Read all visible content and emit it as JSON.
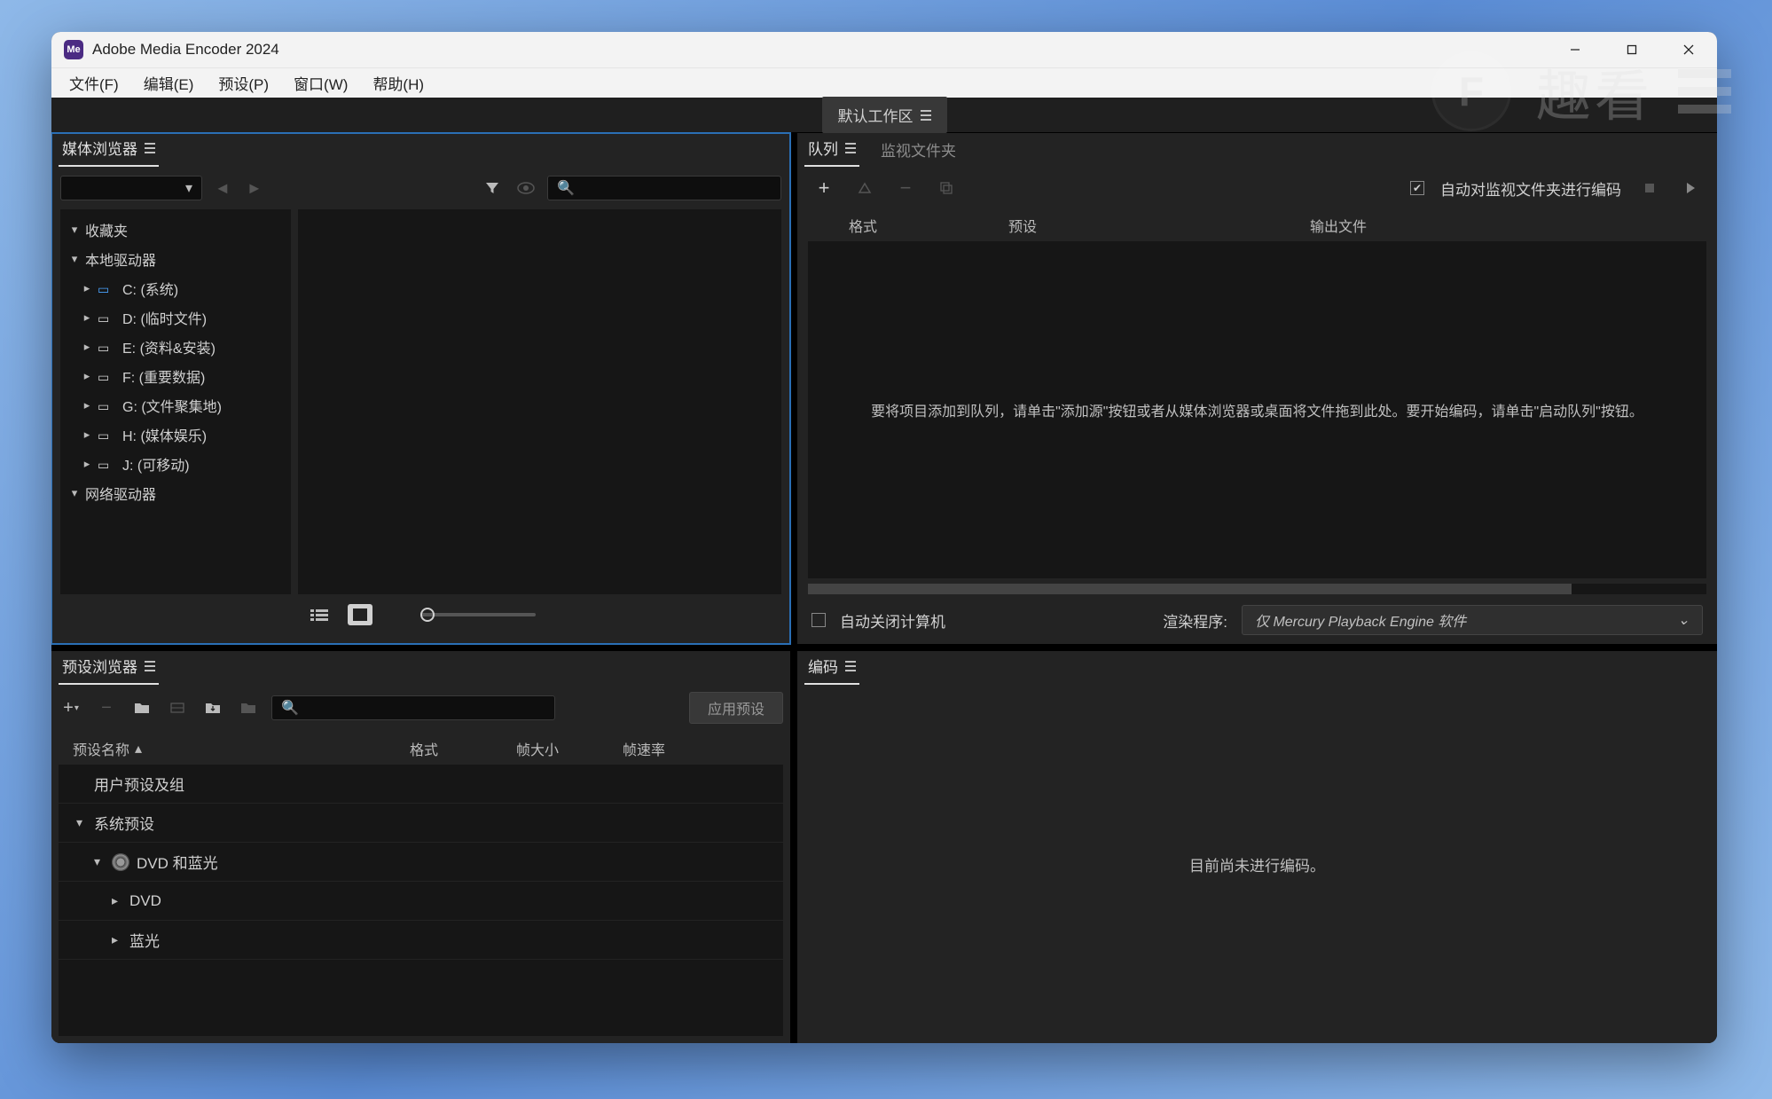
{
  "app": {
    "title": "Adobe Media Encoder 2024",
    "icon_text": "Me"
  },
  "menu": {
    "file": "文件(F)",
    "edit": "编辑(E)",
    "preset": "预设(P)",
    "window": "窗口(W)",
    "help": "帮助(H)"
  },
  "workspace": {
    "default": "默认工作区"
  },
  "mediaBrowser": {
    "tab": "媒体浏览器",
    "tree": {
      "favorites": "收藏夹",
      "localDrives": "本地驱动器",
      "drives": [
        {
          "label": "C: (系统)",
          "blue": true
        },
        {
          "label": "D: (临时文件)"
        },
        {
          "label": "E: (资料&安装)"
        },
        {
          "label": "F: (重要数据)"
        },
        {
          "label": "G: (文件聚集地)"
        },
        {
          "label": "H: (媒体娱乐)"
        },
        {
          "label": "J: (可移动)"
        }
      ],
      "networkDrives": "网络驱动器"
    }
  },
  "presetBrowser": {
    "tab": "预设浏览器",
    "applyBtn": "应用预设",
    "cols": {
      "name": "预设名称",
      "format": "格式",
      "frameSize": "帧大小",
      "frameRate": "帧速率"
    },
    "rows": {
      "userPresets": "用户预设及组",
      "systemPresets": "系统预设",
      "dvdBluray": "DVD 和蓝光",
      "dvd": "DVD",
      "bluray": "蓝光"
    }
  },
  "queue": {
    "tab": "队列",
    "watchTab": "监视文件夹",
    "autoEncode": "自动对监视文件夹进行编码",
    "cols": {
      "format": "格式",
      "preset": "预设",
      "output": "输出文件"
    },
    "dropHint": "要将项目添加到队列，请单击\"添加源\"按钮或者从媒体浏览器或桌面将文件拖到此处。要开始编码，请单击\"启动队列\"按钮。",
    "autoShutdown": "自动关闭计算机",
    "rendererLabel": "渲染程序:",
    "rendererValue": "仅 Mercury Playback Engine 软件"
  },
  "encoding": {
    "tab": "编码",
    "idle": "目前尚未进行编码。"
  },
  "watermark": {
    "letter": "F",
    "text": "趣看"
  }
}
